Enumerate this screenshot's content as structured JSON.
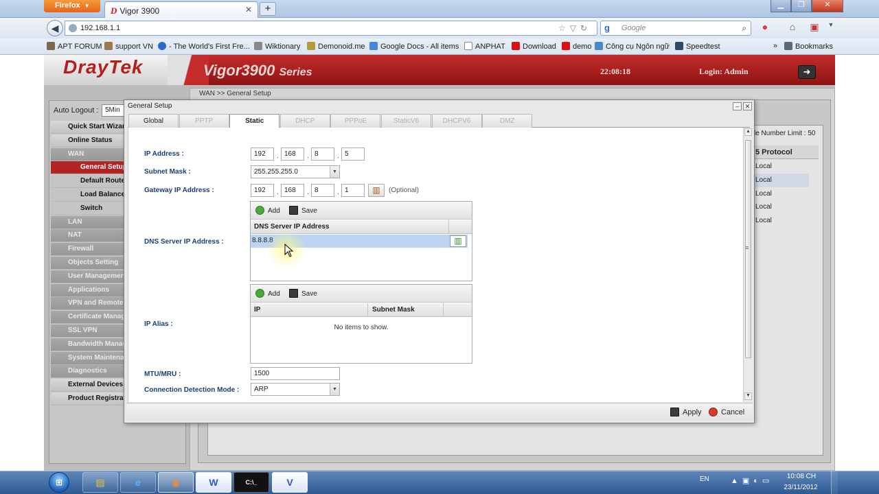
{
  "browser": {
    "firefox_button": "Firefox",
    "tab_title": "Vigor 3900",
    "url": "192.168.1.1",
    "search_placeholder": "Google",
    "bookmarks": [
      "APT FORUM",
      "support VN",
      "- The World's First Fre...",
      "Wiktionary",
      "Demonoid.me",
      "Google Docs - All items",
      "ANPHAT",
      "Download",
      "demo",
      "Công cụ Ngôn ngữ",
      "Speedtest",
      "Bookmarks"
    ],
    "bookmarks_overflow": "»"
  },
  "router": {
    "brand": "DrayTek",
    "model": "Vigor3900",
    "series": "Series",
    "time": "22:08:18",
    "login": "Login: Admin",
    "auto_logout_label": "Auto Logout :",
    "auto_logout_value": "5Min",
    "menu": [
      {
        "label": "Quick Start Wizard",
        "style": "dark"
      },
      {
        "label": "Online Status",
        "style": "dark"
      },
      {
        "label": "WAN",
        "style": "grey"
      },
      {
        "label": "General Setup",
        "style": "active"
      },
      {
        "label": "Default Route",
        "style": "sub"
      },
      {
        "label": "Load Balance",
        "style": "sub"
      },
      {
        "label": "Switch",
        "style": "sub"
      },
      {
        "label": "LAN",
        "style": "grey"
      },
      {
        "label": "NAT",
        "style": "grey"
      },
      {
        "label": "Firewall",
        "style": "grey"
      },
      {
        "label": "Objects Setting",
        "style": "grey"
      },
      {
        "label": "User Management",
        "style": "grey"
      },
      {
        "label": "Applications",
        "style": "grey"
      },
      {
        "label": "VPN and Remote Access",
        "style": "grey"
      },
      {
        "label": "Certificate Management",
        "style": "grey"
      },
      {
        "label": "SSL VPN",
        "style": "grey"
      },
      {
        "label": "Bandwidth Management",
        "style": "grey"
      },
      {
        "label": "System Maintenance",
        "style": "grey"
      },
      {
        "label": "Diagnostics",
        "style": "grey"
      },
      {
        "label": "External Devices",
        "style": "dark"
      },
      {
        "label": "Product Registration",
        "style": "dark"
      }
    ],
    "breadcrumb": "WAN >> General Setup",
    "bg_limit": "le Number Limit :  50",
    "bg_col": "5 Protocol",
    "bg_rows": [
      "Local",
      "Local",
      "Local",
      "Local",
      "Local"
    ]
  },
  "dialog": {
    "title": "General Setup",
    "tabs": [
      {
        "label": "Global",
        "state": "normal"
      },
      {
        "label": "PPTP",
        "state": "disabled"
      },
      {
        "label": "Static",
        "state": "active"
      },
      {
        "label": "DHCP",
        "state": "disabled"
      },
      {
        "label": "PPPoE",
        "state": "disabled"
      },
      {
        "label": "StaticV6",
        "state": "disabled"
      },
      {
        "label": "DHCPV6",
        "state": "disabled"
      },
      {
        "label": "DMZ",
        "state": "disabled"
      }
    ],
    "ip_address_label": "IP Address :",
    "ip_address": [
      "192",
      "168",
      "8",
      "5"
    ],
    "subnet_mask_label": "Subnet Mask :",
    "subnet_mask": "255.255.255.0",
    "gateway_label": "Gateway IP Address :",
    "gateway": [
      "192",
      "168",
      "8",
      "1"
    ],
    "gateway_optional": "(Optional)",
    "dns_label": "DNS Server IP Address :",
    "dns_panel": {
      "add": "Add",
      "save": "Save",
      "column": "DNS Server IP Address",
      "rows": [
        "8.8.8.8"
      ]
    },
    "ip_alias_label": "IP Alias :",
    "alias_panel": {
      "add": "Add",
      "save": "Save",
      "columns": [
        "IP",
        "Subnet Mask"
      ],
      "empty_text": "No items to show."
    },
    "mtu_label": "MTU/MRU :",
    "mtu_value": "1500",
    "conn_detect_label": "Connection Detection Mode :",
    "conn_detect_value": "ARP",
    "apply": "Apply",
    "cancel": "Cancel"
  },
  "taskbar": {
    "start": "⊞",
    "apps": [
      "explorer",
      "ie",
      "firefox",
      "word",
      "cmd",
      "visio"
    ],
    "app_labels": [
      "▤",
      "e",
      "◉",
      "W",
      "C:\\_",
      "V"
    ],
    "language": "EN",
    "time": "10:08 CH",
    "date": "23/11/2012"
  },
  "colors": {
    "brand_red": "#b12525",
    "label_blue": "#1d3d78",
    "selected_row": "#bcd4f0"
  }
}
